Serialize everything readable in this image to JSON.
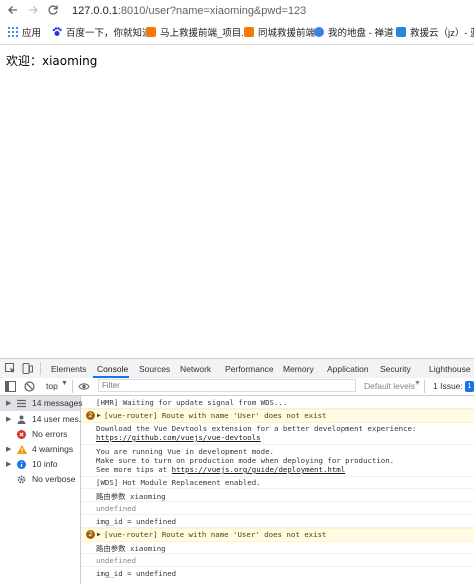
{
  "browser": {
    "url_host": "127.0.0.1",
    "url_rest": ":8010/user?name=xiaoming&pwd=123"
  },
  "bookmarks": [
    {
      "label": "应用",
      "color": "#4285f4"
    },
    {
      "label": "百度一下，你就知道",
      "color": "#2932e1"
    },
    {
      "label": "马上救援前端_项目...",
      "color": "#f57c00"
    },
    {
      "label": "同城救援前端",
      "color": "#f57c00"
    },
    {
      "label": "我的地盘 - 禅道",
      "color": "#3f7ee8"
    },
    {
      "label": "救援云（jz）- 蓝湖",
      "color": "#1e88e5"
    }
  ],
  "page": {
    "welcome": "欢迎：xiaoming"
  },
  "devtools": {
    "tabs": [
      "Elements",
      "Console",
      "Sources",
      "Network",
      "Performance",
      "Memory",
      "Application",
      "Security",
      "Lighthouse"
    ],
    "active_tab": "Console",
    "context": "top",
    "filter_placeholder": "Filter",
    "levels": "Default levels",
    "issues": "1 Issue:",
    "issues_count": "1",
    "sidebar": [
      {
        "label": "14 messages",
        "icon": "list-icon"
      },
      {
        "label": "14 user mes...",
        "icon": "user-icon"
      },
      {
        "label": "No errors",
        "icon": "error-icon"
      },
      {
        "label": "4 warnings",
        "icon": "warning-icon"
      },
      {
        "label": "10 info",
        "icon": "info-icon"
      },
      {
        "label": "No verbose",
        "icon": "verbose-icon"
      }
    ],
    "messages": {
      "m1": "[HMR] Waiting for update signal from WDS...",
      "m2_count": "2",
      "m2": "[vue-router] Route with name 'User' does not exist",
      "m3a": "Download the Vue Devtools extension for a better development experience:",
      "m3b": "https://github.com/vuejs/vue-devtools",
      "m4a": "You are running Vue in development mode.",
      "m4b": "Make sure to turn on production mode when deploying for production.",
      "m4c_pre": "See more tips at ",
      "m4c_link": "https://vuejs.org/guide/deployment.html",
      "m5": "[WDS] Hot Module Replacement enabled.",
      "m6": "路由参数 xiaoming",
      "m7": "undefined",
      "m8": "img_id = undefined",
      "m9_count": "2",
      "m9": "[vue-router] Route with name 'User' does not exist",
      "m10": "路由参数 xiaoming",
      "m11": "undefined",
      "m12": "img_id = undefined"
    }
  }
}
